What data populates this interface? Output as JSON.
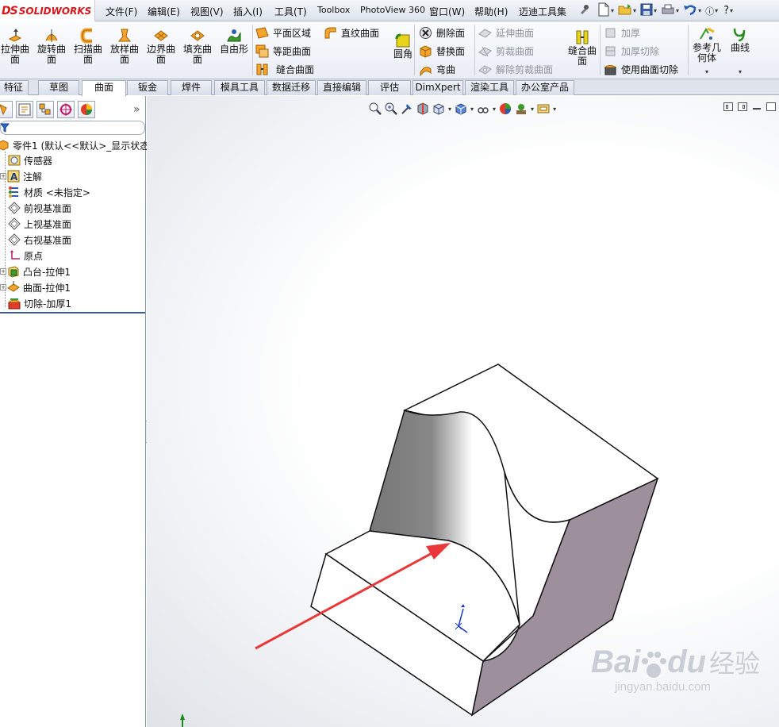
{
  "app": {
    "logo_ds": "DS",
    "logo_name": "SOLIDWORKS"
  },
  "menu": {
    "items": [
      "文件(F)",
      "编辑(E)",
      "视图(V)",
      "插入(I)",
      "工具(T)",
      "Toolbox",
      "PhotoView 360",
      "窗口(W)",
      "帮助(H)",
      "迈迪工具集"
    ]
  },
  "quick_access": {
    "help": "?"
  },
  "command_manager": {
    "big_buttons": [
      {
        "label_1": "拉伸曲",
        "label_2": "面",
        "icon": "extrude-surface-icon"
      },
      {
        "label_1": "旋转曲",
        "label_2": "面",
        "icon": "revolve-surface-icon"
      },
      {
        "label_1": "扫描曲",
        "label_2": "面",
        "icon": "sweep-surface-icon"
      },
      {
        "label_1": "放样曲",
        "label_2": "面",
        "icon": "loft-surface-icon"
      },
      {
        "label_1": "边界曲",
        "label_2": "面",
        "icon": "boundary-surface-icon"
      },
      {
        "label_1": "填充曲",
        "label_2": "面",
        "icon": "fill-surface-icon"
      },
      {
        "label_1": "自由形",
        "label_2": "",
        "icon": "freeform-icon"
      }
    ],
    "col1": [
      "平面区域",
      "等距曲面",
      "缝合曲面"
    ],
    "ruled": "直纹曲面",
    "fillet": "圆角",
    "col2": [
      "删除面",
      "替换面",
      "弯曲"
    ],
    "col3_disabled": [
      "延伸曲面",
      "剪裁曲面",
      "解除剪裁曲面"
    ],
    "knit": {
      "label_1": "缝合曲",
      "label_2": "面"
    },
    "col4": [
      {
        "label": "加厚",
        "disabled": true
      },
      {
        "label": "加厚切除",
        "disabled": true
      },
      {
        "label": "使用曲面切除",
        "disabled": false
      }
    ],
    "ref_geom": {
      "label_1": "参考几",
      "label_2": "何体"
    },
    "curves": "曲线"
  },
  "tabs": [
    "特征",
    "草图",
    "曲面",
    "钣金",
    "焊件",
    "模具工具",
    "数据迁移",
    "直接编辑",
    "评估",
    "DimXpert",
    "渲染工具",
    "办公室产品"
  ],
  "active_tab": "曲面",
  "feature_tree": {
    "root": "零件1 (默认<<默认>_显示状态",
    "items": [
      {
        "label": "传感器",
        "icon": "sensor-icon",
        "expandable": false
      },
      {
        "label": "注解",
        "icon": "annotation-icon",
        "expandable": true
      },
      {
        "label": "材质 <未指定>",
        "icon": "material-icon",
        "expandable": false
      },
      {
        "label": "前视基准面",
        "icon": "plane-icon",
        "expandable": false
      },
      {
        "label": "上视基准面",
        "icon": "plane-icon",
        "expandable": false
      },
      {
        "label": "右视基准面",
        "icon": "plane-icon",
        "expandable": false
      },
      {
        "label": "原点",
        "icon": "origin-icon",
        "expandable": false
      },
      {
        "label": "凸台-拉伸1",
        "icon": "boss-extrude-icon",
        "expandable": true
      },
      {
        "label": "曲面-拉伸1",
        "icon": "surface-extrude-icon",
        "expandable": true
      },
      {
        "label": "切除-加厚1",
        "icon": "cut-thicken-icon",
        "expandable": false
      }
    ]
  },
  "colors": {
    "accent_red": "#e8383a",
    "tree_line": "#3a5ba0",
    "part_side": "#9e8f9d"
  },
  "watermark": {
    "brand": "Bai",
    "brand2": "du",
    "cn": "经验",
    "url": "jingyan.baidu.com"
  }
}
